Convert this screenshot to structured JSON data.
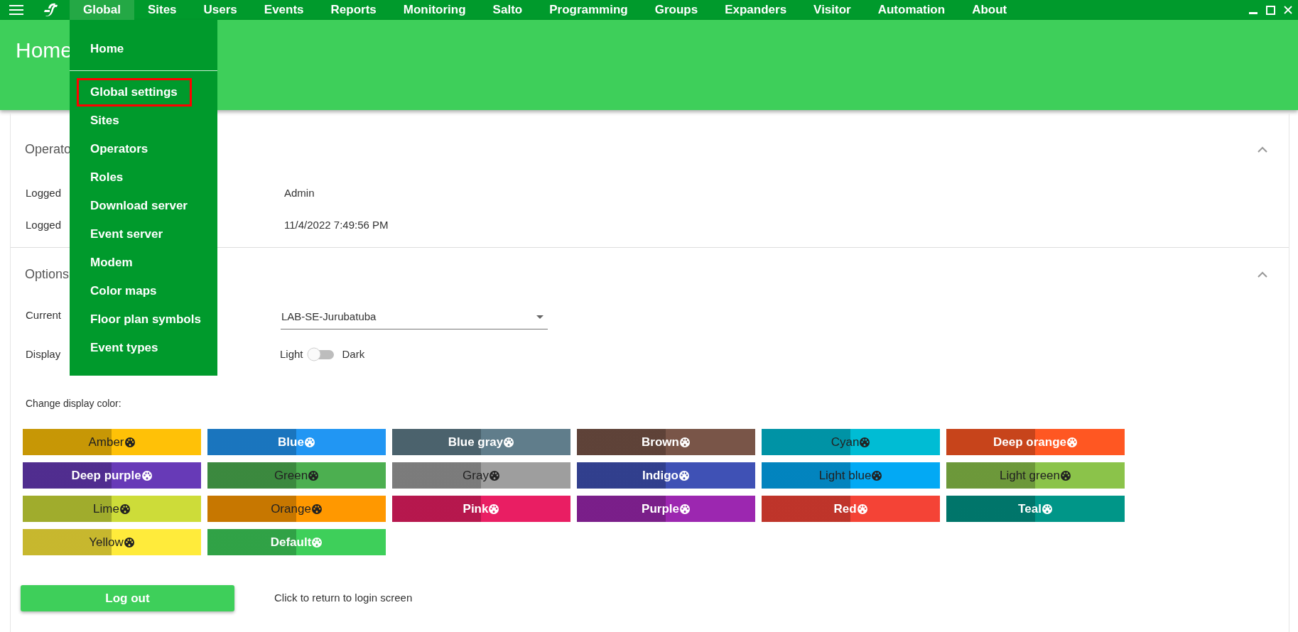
{
  "menu_bar": {
    "items": [
      {
        "label": "Global",
        "selected": true
      },
      {
        "label": "Sites",
        "selected": false
      },
      {
        "label": "Users",
        "selected": false
      },
      {
        "label": "Events",
        "selected": false
      },
      {
        "label": "Reports",
        "selected": false
      },
      {
        "label": "Monitoring",
        "selected": false
      },
      {
        "label": "Salto",
        "selected": false
      },
      {
        "label": "Programming",
        "selected": false
      },
      {
        "label": "Groups",
        "selected": false
      },
      {
        "label": "Expanders",
        "selected": false
      },
      {
        "label": "Visitor",
        "selected": false
      },
      {
        "label": "Automation",
        "selected": false
      },
      {
        "label": "About",
        "selected": false
      }
    ]
  },
  "header": {
    "title": "Home"
  },
  "dropdown": {
    "items": [
      {
        "label": "Home",
        "selected": false
      },
      {
        "label": "Global settings",
        "selected": true
      },
      {
        "label": "Sites",
        "selected": false
      },
      {
        "label": "Operators",
        "selected": false
      },
      {
        "label": "Roles",
        "selected": false
      },
      {
        "label": "Download server",
        "selected": false
      },
      {
        "label": "Event server",
        "selected": false
      },
      {
        "label": "Modem",
        "selected": false
      },
      {
        "label": "Color maps",
        "selected": false
      },
      {
        "label": "Floor plan symbols",
        "selected": false
      },
      {
        "label": "Event types",
        "selected": false
      }
    ]
  },
  "operator_section": {
    "title": "Operato",
    "expanded": true,
    "rows": [
      {
        "label": "Logged",
        "value": "Admin"
      },
      {
        "label": "Logged",
        "value": "11/4/2022 7:49:56 PM"
      }
    ]
  },
  "options_section": {
    "title": "Options",
    "expanded": true,
    "site": {
      "label": "Current",
      "value": "LAB-SE-Jurubatuba"
    },
    "theme": {
      "label": "Display",
      "off_label": "Light",
      "on_label": "Dark",
      "on": false
    },
    "color_label": "Change display color:",
    "colors": [
      {
        "label": "Amber",
        "color": "#ffc107",
        "light_text": false
      },
      {
        "label": "Blue",
        "color": "#2196f3",
        "light_text": true
      },
      {
        "label": "Blue gray",
        "color": "#607d8b",
        "light_text": true
      },
      {
        "label": "Brown",
        "color": "#795548",
        "light_text": true
      },
      {
        "label": "Cyan",
        "color": "#00bcd4",
        "light_text": false
      },
      {
        "label": "Deep orange",
        "color": "#ff5722",
        "light_text": true
      },
      {
        "label": "Deep purple",
        "color": "#673ab7",
        "light_text": true
      },
      {
        "label": "Green",
        "color": "#4caf50",
        "light_text": false
      },
      {
        "label": "Gray",
        "color": "#9e9e9e",
        "light_text": false
      },
      {
        "label": "Indigo",
        "color": "#3f51b5",
        "light_text": true
      },
      {
        "label": "Light blue",
        "color": "#03a9f4",
        "light_text": false
      },
      {
        "label": "Light green",
        "color": "#8bc34a",
        "light_text": false
      },
      {
        "label": "Lime",
        "color": "#cddc39",
        "light_text": false
      },
      {
        "label": "Orange",
        "color": "#ff9800",
        "light_text": false
      },
      {
        "label": "Pink",
        "color": "#e91e63",
        "light_text": true
      },
      {
        "label": "Purple",
        "color": "#9c27b0",
        "light_text": true
      },
      {
        "label": "Red",
        "color": "#f44336",
        "light_text": true
      },
      {
        "label": "Teal",
        "color": "#009688",
        "light_text": true
      },
      {
        "label": "Yellow",
        "color": "#ffeb3b",
        "light_text": false
      },
      {
        "label": "Default",
        "color": "#3ecf5a",
        "light_text": true
      }
    ],
    "logout": {
      "button": "Log out",
      "hint": "Click to return to login screen"
    }
  }
}
